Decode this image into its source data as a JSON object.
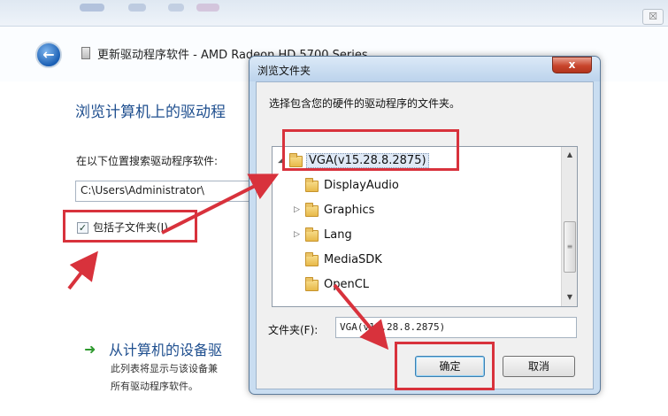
{
  "wizard": {
    "title": "更新驱动程序软件 - AMD Radeon HD 5700 Series",
    "heading": "浏览计算机上的驱动程",
    "search_label": "在以下位置搜索驱动程序软件:",
    "path_value": "C:\\Users\\Administrator\\",
    "include_subfolders_label": "包括子文件夹(I)",
    "include_subfolders_checked": true,
    "option_title": "从计算机的设备驱",
    "option_desc_line1": "此列表将显示与该设备兼",
    "option_desc_line2": "所有驱动程序软件。"
  },
  "dialog": {
    "title": "浏览文件夹",
    "close_glyph": "x",
    "instruction": "选择包含您的硬件的驱动程序的文件夹。",
    "tree": [
      {
        "label": "VGA(v15.28.8.2875)",
        "expander": "◢",
        "selected": true
      },
      {
        "label": "DisplayAudio",
        "expander": ""
      },
      {
        "label": "Graphics",
        "expander": "▷"
      },
      {
        "label": "Lang",
        "expander": "▷"
      },
      {
        "label": "MediaSDK",
        "expander": ""
      },
      {
        "label": "OpenCL",
        "expander": ""
      }
    ],
    "folder_label": "文件夹(F):",
    "folder_value": "VGA(v15.28.8.2875)",
    "ok_label": "确定",
    "cancel_label": "取消"
  },
  "colors": {
    "annotation_red": "#d8323c",
    "heading_blue": "#1f4f8f"
  },
  "icons": [
    "back-arrow-icon",
    "driver-chip-icon",
    "close-icon",
    "folder-icon",
    "expander-icon",
    "checkmark-icon",
    "green-arrow-icon",
    "scroll-up-icon",
    "scroll-down-icon"
  ]
}
